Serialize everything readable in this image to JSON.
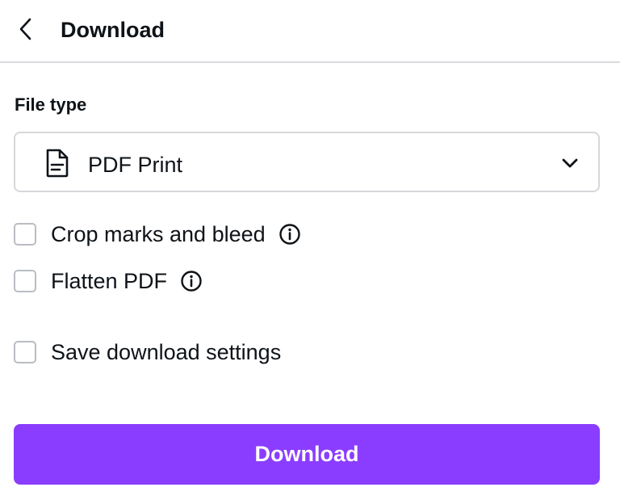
{
  "header": {
    "title": "Download",
    "back_icon": "chevron-left-icon"
  },
  "file_type": {
    "label": "File type",
    "selected": "PDF Print",
    "icon": "document-icon",
    "dropdown_icon": "chevron-down-icon"
  },
  "options": [
    {
      "label": "Crop marks and bleed",
      "checked": false,
      "has_info": true
    },
    {
      "label": "Flatten PDF",
      "checked": false,
      "has_info": true
    },
    {
      "label": "Save download settings",
      "checked": false,
      "has_info": false
    }
  ],
  "download_button": {
    "label": "Download",
    "color": "#8b3dff"
  }
}
